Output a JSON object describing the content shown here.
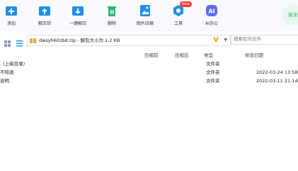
{
  "toolbar": {
    "items": [
      {
        "label": "添加",
        "icon": "add-icon",
        "color": "#1e8fe8"
      },
      {
        "label": "解压到",
        "icon": "extract-to-icon",
        "color": "#1e8fe8"
      },
      {
        "label": "一键解压",
        "icon": "one-click-extract-icon",
        "color": "#1e8fe8"
      },
      {
        "label": "删除",
        "icon": "delete-icon",
        "color": "#2bb673"
      },
      {
        "label": "图片压缩",
        "icon": "image-compress-icon",
        "color": "#1e8fe8"
      },
      {
        "label": "工具",
        "icon": "tools-icon",
        "color": "#1e8fe8"
      },
      {
        "label": "AI办公",
        "icon": "ai-office-icon",
        "color": "#5b6cf0"
      }
    ],
    "badge": "New",
    "safe_label": "安全"
  },
  "address": {
    "path": "dwsyh60zbd.zip - 解包大小为 1.2 KB",
    "search_placeholder": "搜索包内文件"
  },
  "columns": [
    "压缩前",
    "压缩后",
    "类型",
    "修改日期"
  ],
  "rows": [
    {
      "name": ". (上级目录)",
      "type": "文件夹",
      "date": ""
    },
    {
      "name": "不知道",
      "type": "文件夹",
      "date": "2022-03-24 13:58"
    },
    {
      "name": "说明",
      "type": "文件夹",
      "date": "2022-03-11 21:14"
    }
  ],
  "colors": {
    "accent": "#1e8fe8",
    "toolbar_bg": "#f7f9fc"
  }
}
